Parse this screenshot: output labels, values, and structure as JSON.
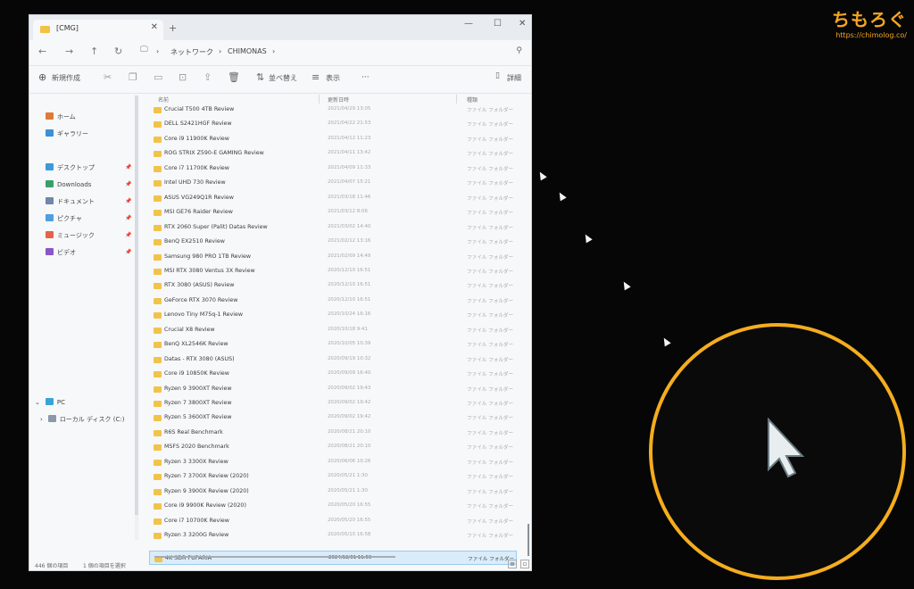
{
  "tab": {
    "title": "[CMG]",
    "close": "✕",
    "new": "+"
  },
  "window_controls": [
    "—",
    "☐",
    "✕"
  ],
  "nav": {
    "back": "←",
    "forward": "→",
    "up": "↑",
    "refresh": "↻",
    "pc": "🖵",
    "sep": "›"
  },
  "breadcrumb": [
    "ネットワーク",
    "CHIMONAS"
  ],
  "toolbar": {
    "new": "新規作成",
    "sort": "並べ替え",
    "view": "表示",
    "more": "···",
    "details": "詳細"
  },
  "sidebar": {
    "quick": [
      {
        "label": "ホーム",
        "color": "#e07a3a"
      },
      {
        "label": "ギャラリー",
        "color": "#3d8fd6"
      }
    ],
    "pinned": [
      {
        "label": "デスクトップ",
        "color": "#3b9ad9"
      },
      {
        "label": "Downloads",
        "color": "#3aa06b"
      },
      {
        "label": "ドキュメント",
        "color": "#6f87a8"
      },
      {
        "label": "ピクチャ",
        "color": "#4f9ee0"
      },
      {
        "label": "ミュージック",
        "color": "#e2654a"
      },
      {
        "label": "ビデオ",
        "color": "#8a56c7"
      }
    ],
    "pc": "PC",
    "local": "ローカル ディスク (C:)"
  },
  "columns": {
    "name": "名前",
    "date": "更新日時",
    "type": "種類"
  },
  "files": [
    {
      "name": "Crucial T500 4TB Review",
      "date": "2021/04/29 13:05",
      "type": "ファイル フォルダー"
    },
    {
      "name": "DELL S2421HGF Review",
      "date": "2021/04/22 21:53",
      "type": "ファイル フォルダー"
    },
    {
      "name": "Core i9 11900K Review",
      "date": "2021/04/12 11:23",
      "type": "ファイル フォルダー"
    },
    {
      "name": "ROG STRIX Z590-E GAMING Review",
      "date": "2021/04/11 13:42",
      "type": "ファイル フォルダー"
    },
    {
      "name": "Core i7 11700K Review",
      "date": "2021/04/09 11:33",
      "type": "ファイル フォルダー"
    },
    {
      "name": "Intel UHD 730 Review",
      "date": "2021/04/07 15:21",
      "type": "ファイル フォルダー"
    },
    {
      "name": "ASUS VG249Q1R Review",
      "date": "2021/03/18 11:46",
      "type": "ファイル フォルダー"
    },
    {
      "name": "MSI GE76 Raider Review",
      "date": "2021/03/12 8:06",
      "type": "ファイル フォルダー"
    },
    {
      "name": "RTX 2060 Super (Palit) Datas Review",
      "date": "2021/03/02 14:40",
      "type": "ファイル フォルダー"
    },
    {
      "name": "BenQ EX2510 Review",
      "date": "2021/02/12 13:16",
      "type": "ファイル フォルダー"
    },
    {
      "name": "Samsung 980 PRO 1TB Review",
      "date": "2021/02/09 14:49",
      "type": "ファイル フォルダー"
    },
    {
      "name": "MSI RTX 3080 Ventus 3X Review",
      "date": "2020/12/10 16:51",
      "type": "ファイル フォルダー"
    },
    {
      "name": "RTX 3080 (ASUS) Review",
      "date": "2020/12/10 16:51",
      "type": "ファイル フォルダー"
    },
    {
      "name": "GeForce RTX 3070 Review",
      "date": "2020/12/10 16:51",
      "type": "ファイル フォルダー"
    },
    {
      "name": "Lenovo Tiny M75q-1 Review",
      "date": "2020/10/24 16:16",
      "type": "ファイル フォルダー"
    },
    {
      "name": "Crucial X8 Review",
      "date": "2020/10/18 9:41",
      "type": "ファイル フォルダー"
    },
    {
      "name": "BenQ XL2546K Review",
      "date": "2020/10/05 10:39",
      "type": "ファイル フォルダー"
    },
    {
      "name": "Datas - RTX 3080 (ASUS)",
      "date": "2020/09/19 10:32",
      "type": "ファイル フォルダー"
    },
    {
      "name": "Core i9 10850K Review",
      "date": "2020/09/09 16:40",
      "type": "ファイル フォルダー"
    },
    {
      "name": "Ryzen 9 3900XT Review",
      "date": "2020/09/02 19:43",
      "type": "ファイル フォルダー"
    },
    {
      "name": "Ryzen 7 3800XT Review",
      "date": "2020/09/02 19:42",
      "type": "ファイル フォルダー"
    },
    {
      "name": "Ryzen 5 3600XT Review",
      "date": "2020/09/02 19:42",
      "type": "ファイル フォルダー"
    },
    {
      "name": "R6S Real Benchmark",
      "date": "2020/08/21 20:10",
      "type": "ファイル フォルダー"
    },
    {
      "name": "MSFS 2020 Benchmark",
      "date": "2020/08/21 20:10",
      "type": "ファイル フォルダー"
    },
    {
      "name": "Ryzen 3 3300X Review",
      "date": "2020/06/06 10:26",
      "type": "ファイル フォルダー"
    },
    {
      "name": "Ryzen 7 3700X Review (2020)",
      "date": "2020/05/21 1:30",
      "type": "ファイル フォルダー"
    },
    {
      "name": "Ryzen 9 3900X Review (2020)",
      "date": "2020/05/21 1:30",
      "type": "ファイル フォルダー"
    },
    {
      "name": "Core i9 9900K Review (2020)",
      "date": "2020/05/20 16:55",
      "type": "ファイル フォルダー"
    },
    {
      "name": "Core i7 10700K Review",
      "date": "2020/05/20 16:55",
      "type": "ファイル フォルダー"
    },
    {
      "name": "Ryzen 3 3200G Review",
      "date": "2020/05/10 16:58",
      "type": "ファイル フォルダー"
    },
    {
      "name": "4K SDR PUPARIA",
      "date": "2024/12/01 11:59",
      "type": "ファイル フォルダー",
      "selected": true
    }
  ],
  "status": {
    "count": "446 個の項目",
    "selected": "1 個の項目を選択"
  },
  "watermark": {
    "brand": "ちもろぐ",
    "url": "https://chimolog.co/"
  },
  "accent": {
    "ring": "#f5ad1d",
    "selection": "#d9ecfa"
  }
}
